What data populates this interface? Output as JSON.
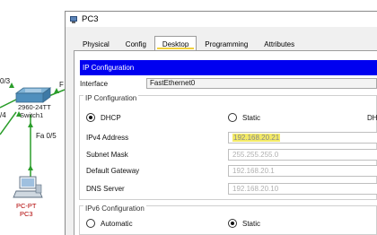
{
  "topology": {
    "port_labels": [
      "0/3",
      "/4",
      "Fa 0/5",
      "F"
    ],
    "switch_name": [
      "2960-24TT",
      "Switch1"
    ],
    "pc_name": [
      "PC-PT",
      "PC3"
    ],
    "link_color": "#2a9d2a"
  },
  "window": {
    "title": "PC3",
    "tabs": [
      "Physical",
      "Config",
      "Desktop",
      "Programming",
      "Attributes"
    ],
    "active_tab": "Desktop"
  },
  "ip_config": {
    "header": "IP Configuration",
    "interface_label": "Interface",
    "interface_value": "FastEthernet0",
    "ipv4_group_title": "IP Configuration",
    "dhcp_label": "DHCP",
    "static_label": "Static",
    "dhcp_cut": "DH",
    "mode": "DHCP",
    "fields": [
      {
        "label": "IPv4 Address",
        "value": "192.168.20.21",
        "highlighted": true
      },
      {
        "label": "Subnet Mask",
        "value": "255.255.255.0"
      },
      {
        "label": "Default Gateway",
        "value": "192.168.20.1"
      },
      {
        "label": "DNS Server",
        "value": "192.168.20.10"
      }
    ],
    "ipv6_group_title": "IPv6 Configuration",
    "ipv6_automatic_label": "Automatic",
    "ipv6_static_label": "Static",
    "ipv6_mode": "Static"
  },
  "colors": {
    "ip_header_bg": "#0000f0",
    "highlight": "#f3ea66",
    "device_label": "#b00000"
  }
}
